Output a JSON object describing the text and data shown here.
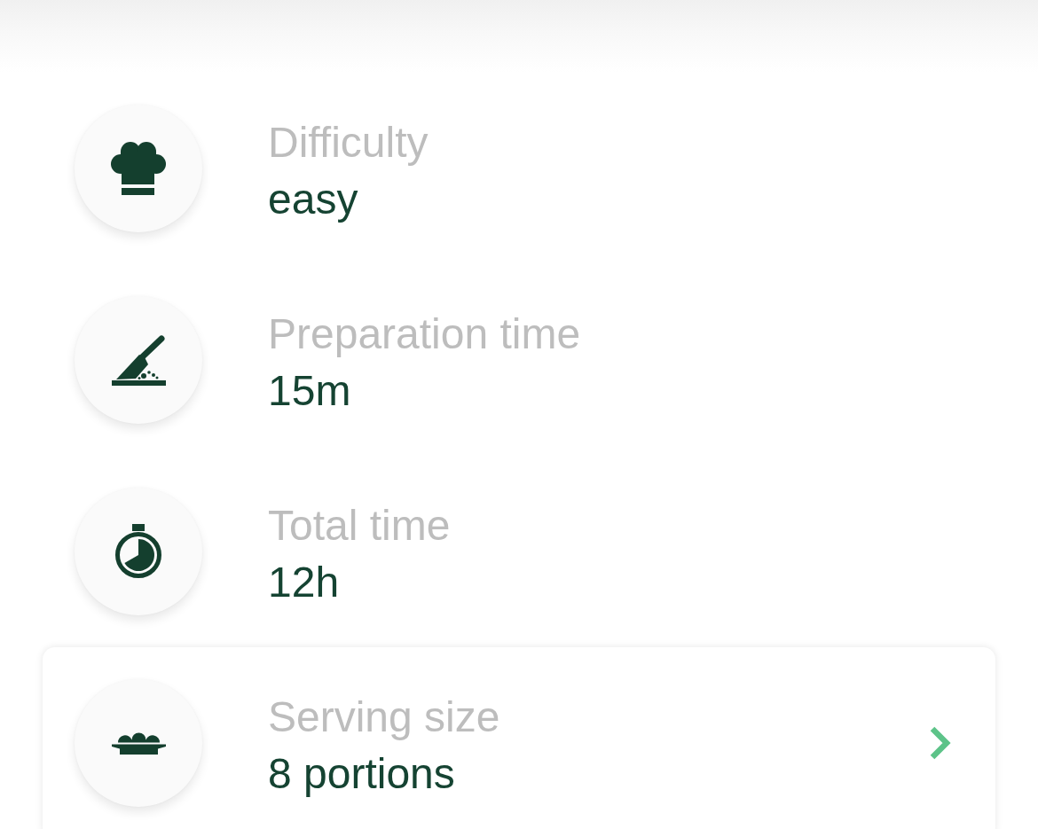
{
  "details": [
    {
      "kind": "info",
      "label": "Difficulty",
      "value": "easy"
    },
    {
      "kind": "info",
      "label": "Preparation time",
      "value": "15m"
    },
    {
      "kind": "info",
      "label": "Total time",
      "value": "12h"
    },
    {
      "kind": "link",
      "label": "Serving size",
      "value": "8 portions"
    }
  ]
}
